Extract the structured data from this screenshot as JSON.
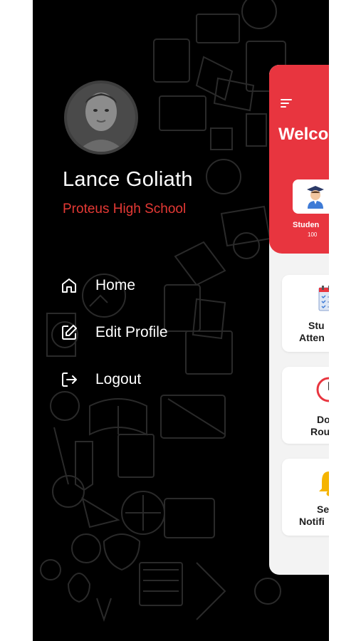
{
  "profile": {
    "name": "Lance Goliath",
    "school": "Proteus High School"
  },
  "menu": [
    {
      "label": "Home",
      "icon": "home-icon"
    },
    {
      "label": "Edit Profile",
      "icon": "edit-icon"
    },
    {
      "label": "Logout",
      "icon": "logout-icon"
    }
  ],
  "dashboard": {
    "welcome": "Welco",
    "stat": {
      "label": "Studen",
      "value": "100",
      "icon": "graduate-icon"
    },
    "tiles": [
      {
        "line1": "Stu",
        "line2": "Atten",
        "icon": "calendar-checklist-icon"
      },
      {
        "line1": "Do",
        "line2": "Rou",
        "icon": "clock-icon"
      },
      {
        "line1": "Se",
        "line2": "Notifi",
        "icon": "bell-icon"
      }
    ]
  },
  "colors": {
    "accent": "#e53935",
    "header": "#e8353f",
    "drawer_background": "#000000"
  }
}
